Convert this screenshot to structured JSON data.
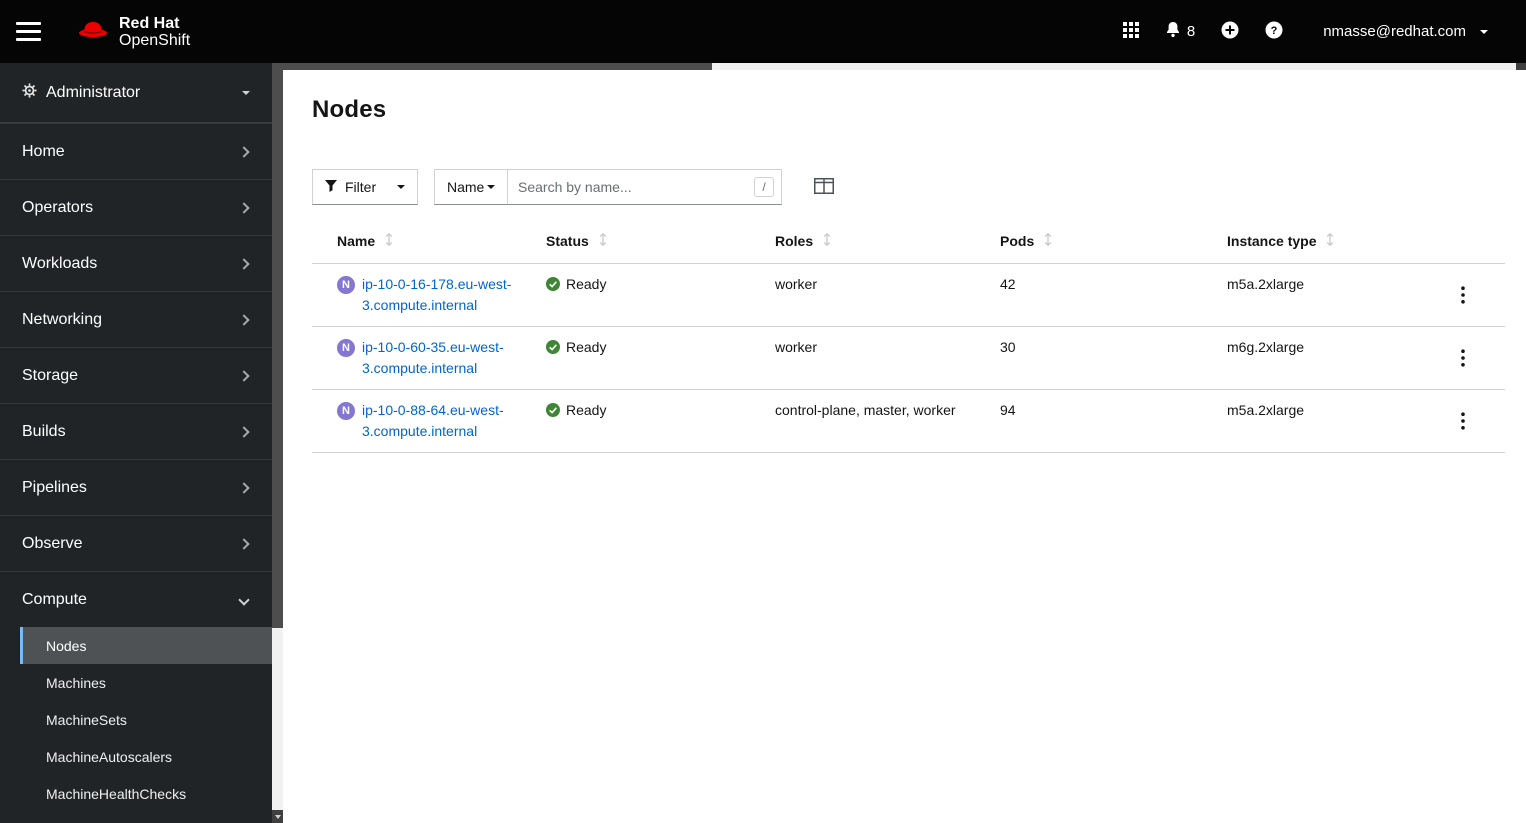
{
  "masthead": {
    "brand": {
      "line1": "Red Hat",
      "line2": "OpenShift"
    },
    "notifications": {
      "count": "8"
    },
    "user": {
      "name": "nmasse@redhat.com"
    }
  },
  "sidebar": {
    "perspective": {
      "label": "Administrator"
    },
    "items": [
      {
        "label": "Home"
      },
      {
        "label": "Operators"
      },
      {
        "label": "Workloads"
      },
      {
        "label": "Networking"
      },
      {
        "label": "Storage"
      },
      {
        "label": "Builds"
      },
      {
        "label": "Pipelines"
      },
      {
        "label": "Observe"
      },
      {
        "label": "Compute"
      }
    ],
    "compute_subitems": [
      {
        "label": "Nodes"
      },
      {
        "label": "Machines"
      },
      {
        "label": "MachineSets"
      },
      {
        "label": "MachineAutoscalers"
      },
      {
        "label": "MachineHealthChecks"
      }
    ]
  },
  "page": {
    "title": "Nodes",
    "toolbar": {
      "filter": {
        "label": "Filter"
      },
      "name_filter": {
        "label": "Name"
      },
      "search": {
        "placeholder": "Search by name...",
        "shortcut": "/"
      }
    },
    "table": {
      "columns": [
        {
          "label": "Name"
        },
        {
          "label": "Status"
        },
        {
          "label": "Roles"
        },
        {
          "label": "Pods"
        },
        {
          "label": "Instance type"
        }
      ],
      "rows": [
        {
          "badge": "N",
          "name": "ip-10-0-16-178.eu-west-3.compute.internal",
          "status": "Ready",
          "roles": "worker",
          "pods": "42",
          "instance_type": "m5a.2xlarge"
        },
        {
          "badge": "N",
          "name": "ip-10-0-60-35.eu-west-3.compute.internal",
          "status": "Ready",
          "roles": "worker",
          "pods": "30",
          "instance_type": "m6g.2xlarge"
        },
        {
          "badge": "N",
          "name": "ip-10-0-88-64.eu-west-3.compute.internal",
          "status": "Ready",
          "roles": "control-plane, master, worker",
          "pods": "94",
          "instance_type": "m5a.2xlarge"
        }
      ]
    }
  },
  "colors": {
    "link_blue": "#0066cc",
    "success_green": "#3e8635",
    "node_badge_purple": "#8476d1",
    "active_nav_border": "#73bcf7",
    "brand_red": "#ee0000",
    "masthead_black": "#050505",
    "sidebar_dark": "#212427"
  }
}
